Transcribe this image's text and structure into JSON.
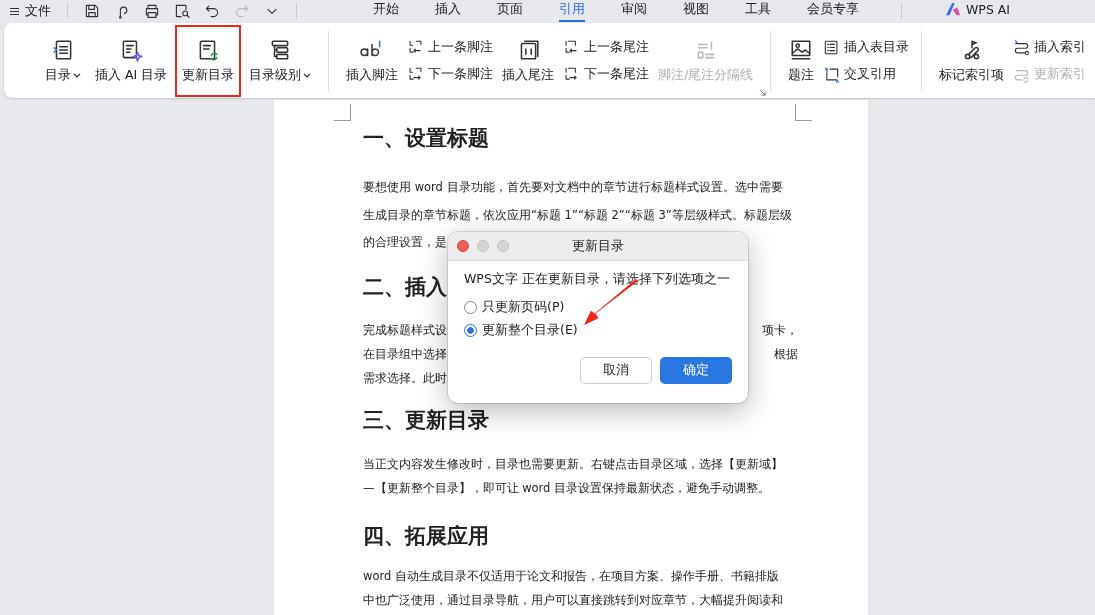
{
  "menu": {
    "label": "文件"
  },
  "quick_tools": [
    {
      "kind": "save",
      "disabled": false
    },
    {
      "kind": "curl",
      "disabled": false
    },
    {
      "kind": "print",
      "disabled": false
    },
    {
      "kind": "preview",
      "disabled": false
    },
    {
      "kind": "undo",
      "disabled": false
    },
    {
      "kind": "redo",
      "disabled": true
    },
    {
      "kind": "more",
      "disabled": false
    }
  ],
  "tabs": [
    {
      "label": "开始",
      "selected": false,
      "kind": "text"
    },
    {
      "label": "插入",
      "selected": false,
      "kind": "text"
    },
    {
      "label": "页面",
      "selected": false,
      "kind": "text"
    },
    {
      "label": "引用",
      "selected": true,
      "kind": "text"
    },
    {
      "label": "审阅",
      "selected": false,
      "kind": "text"
    },
    {
      "label": "视图",
      "selected": false,
      "kind": "text"
    },
    {
      "label": "工具",
      "selected": false,
      "kind": "text"
    },
    {
      "label": "会员专享",
      "selected": false,
      "kind": "text"
    },
    {
      "label": "WPS AI",
      "selected": false,
      "kind": "ai"
    }
  ],
  "ribbon": {
    "groups": [
      {
        "items": [
          {
            "kind": "large",
            "label": "目录",
            "dropdown": true,
            "highlighted": false,
            "disabled": false
          },
          {
            "kind": "large",
            "label": "插入 AI 目录",
            "dropdown": false,
            "highlighted": false,
            "disabled": false
          },
          {
            "kind": "large",
            "label": "更新目录",
            "dropdown": false,
            "highlighted": true,
            "disabled": false
          },
          {
            "kind": "large",
            "label": "目录级别",
            "dropdown": true,
            "highlighted": false,
            "disabled": false
          }
        ]
      },
      {
        "launcher": true,
        "items": [
          {
            "kind": "large",
            "label": "插入脚注",
            "dropdown": false,
            "highlighted": false,
            "disabled": false
          },
          {
            "kind": "stack",
            "buttons": [
              {
                "label": "上一条脚注",
                "disabled": false
              },
              {
                "label": "下一条脚注",
                "disabled": false
              }
            ]
          },
          {
            "kind": "large",
            "label": "插入尾注",
            "dropdown": false,
            "highlighted": false,
            "disabled": false
          },
          {
            "kind": "stack",
            "buttons": [
              {
                "label": "上一条尾注",
                "disabled": false
              },
              {
                "label": "下一条尾注",
                "disabled": false
              }
            ]
          },
          {
            "kind": "large",
            "label": "脚注/尾注分隔线",
            "dropdown": false,
            "highlighted": false,
            "disabled": true
          }
        ]
      },
      {
        "items": [
          {
            "kind": "large",
            "label": "题注",
            "dropdown": false,
            "highlighted": false,
            "disabled": false
          },
          {
            "kind": "stack",
            "buttons": [
              {
                "label": "插入表目录",
                "disabled": false
              },
              {
                "label": "交叉引用",
                "disabled": false
              }
            ]
          }
        ]
      },
      {
        "items": [
          {
            "kind": "large",
            "label": "标记索引项",
            "dropdown": false,
            "highlighted": false,
            "disabled": false
          },
          {
            "kind": "stack",
            "buttons": [
              {
                "label": "插入索引",
                "disabled": false
              },
              {
                "label": "更新索引",
                "disabled": true
              }
            ]
          }
        ]
      }
    ]
  },
  "document": {
    "sections": [
      {
        "heading": "一、设置标题",
        "lines": [
          {
            "left": "要想使用 word 目录功能，首先要对文档中的章节进行标题样式设置。选中需要"
          },
          {
            "left": "生成目录的章节标题，依次应用“标题 1”“标题 2”“标题 3”等层级样式。标题层级"
          },
          {
            "left": "的合理设置，是"
          }
        ]
      },
      {
        "heading": "二、插入",
        "lines": [
          {
            "left": "完成标题样式设",
            "right": "项卡，"
          },
          {
            "left": "在目录组中选择",
            "right": "根据"
          },
          {
            "left": "需求选择。此时"
          }
        ]
      },
      {
        "heading": "三、更新目录",
        "lines": [
          {
            "left": "当正文内容发生修改时，目录也需要更新。右键点击目录区域，选择【更新域】"
          },
          {
            "left": "—【更新整个目录】，即可让 word 目录设置保持最新状态，避免手动调整。"
          }
        ]
      },
      {
        "heading": "四、拓展应用",
        "lines": [
          {
            "left": "word 自动生成目录不仅适用于论文和报告，在项目方案、操作手册、书籍排版"
          },
          {
            "left": "中也广泛使用，通过目录导航，用户可以直接跳转到对应章节，大幅提升阅读和"
          }
        ]
      }
    ]
  },
  "dialog": {
    "title": "更新目录",
    "message": "WPS文字 正在更新目录，请选择下列选项之一",
    "options": [
      {
        "label": "只更新页码(P)",
        "selected": false
      },
      {
        "label": "更新整个目录(E)",
        "selected": true,
        "arrow": true
      }
    ],
    "buttons": [
      {
        "label": "取消",
        "kind": "secondary"
      },
      {
        "label": "确定",
        "kind": "primary"
      }
    ]
  }
}
